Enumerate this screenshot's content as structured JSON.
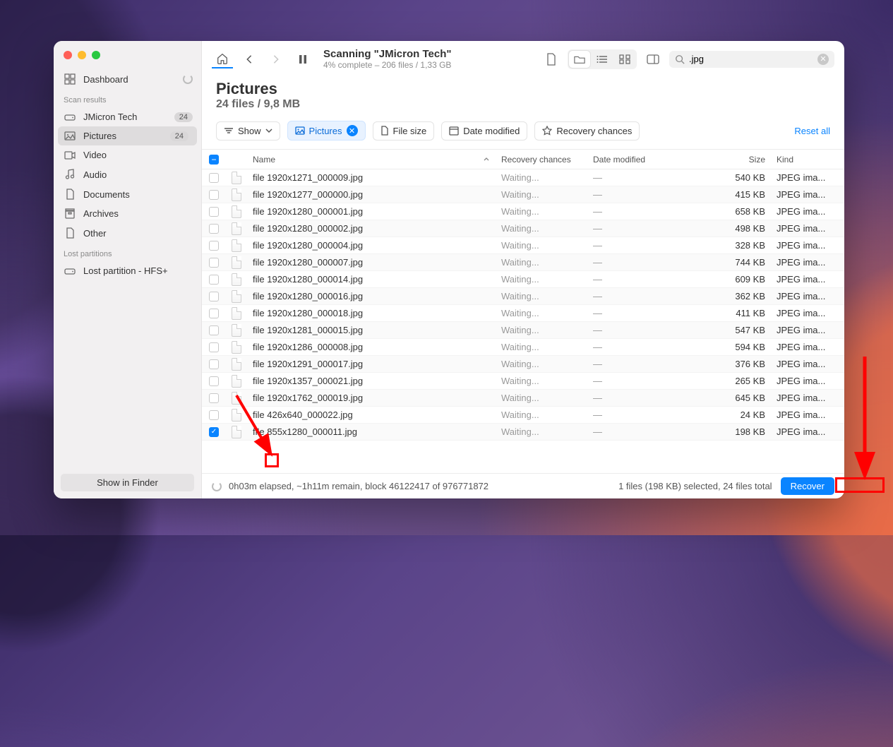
{
  "sidebar": {
    "dashboard": "Dashboard",
    "scan_results_header": "Scan results",
    "items": [
      {
        "id": "drive",
        "label": "JMicron Tech",
        "icon": "drive-icon",
        "badge": "24"
      },
      {
        "id": "pictures",
        "label": "Pictures",
        "icon": "picture-icon",
        "badge": "24",
        "selected": true
      },
      {
        "id": "video",
        "label": "Video",
        "icon": "video-icon"
      },
      {
        "id": "audio",
        "label": "Audio",
        "icon": "audio-icon"
      },
      {
        "id": "documents",
        "label": "Documents",
        "icon": "document-icon"
      },
      {
        "id": "archives",
        "label": "Archives",
        "icon": "archive-icon"
      },
      {
        "id": "other",
        "label": "Other",
        "icon": "other-icon"
      }
    ],
    "lost_header": "Lost partitions",
    "lost_items": [
      {
        "id": "hfs",
        "label": "Lost partition - HFS+",
        "icon": "drive-icon"
      }
    ],
    "show_in_finder": "Show in Finder"
  },
  "toolbar": {
    "scan_title": "Scanning \"JMicron Tech\"",
    "scan_sub": "4% complete – 206 files / 1,33 GB",
    "search_value": ".jpg"
  },
  "heading": {
    "title": "Pictures",
    "subtitle": "24 files / 9,8 MB"
  },
  "filters": {
    "show_label": "Show",
    "pictures_pill": "Pictures",
    "filesize_pill": "File size",
    "date_pill": "Date modified",
    "recovery_pill": "Recovery chances",
    "reset": "Reset all"
  },
  "columns": {
    "name": "Name",
    "recovery": "Recovery chances",
    "date": "Date modified",
    "size": "Size",
    "kind": "Kind"
  },
  "rows": [
    {
      "name": "file 1920x1271_000009.jpg",
      "rec": "Waiting...",
      "date": "—",
      "size": "540 KB",
      "kind": "JPEG ima...",
      "checked": false
    },
    {
      "name": "file 1920x1277_000000.jpg",
      "rec": "Waiting...",
      "date": "—",
      "size": "415 KB",
      "kind": "JPEG ima...",
      "checked": false
    },
    {
      "name": "file 1920x1280_000001.jpg",
      "rec": "Waiting...",
      "date": "—",
      "size": "658 KB",
      "kind": "JPEG ima...",
      "checked": false
    },
    {
      "name": "file 1920x1280_000002.jpg",
      "rec": "Waiting...",
      "date": "—",
      "size": "498 KB",
      "kind": "JPEG ima...",
      "checked": false
    },
    {
      "name": "file 1920x1280_000004.jpg",
      "rec": "Waiting...",
      "date": "—",
      "size": "328 KB",
      "kind": "JPEG ima...",
      "checked": false
    },
    {
      "name": "file 1920x1280_000007.jpg",
      "rec": "Waiting...",
      "date": "—",
      "size": "744 KB",
      "kind": "JPEG ima...",
      "checked": false
    },
    {
      "name": "file 1920x1280_000014.jpg",
      "rec": "Waiting...",
      "date": "—",
      "size": "609 KB",
      "kind": "JPEG ima...",
      "checked": false
    },
    {
      "name": "file 1920x1280_000016.jpg",
      "rec": "Waiting...",
      "date": "—",
      "size": "362 KB",
      "kind": "JPEG ima...",
      "checked": false
    },
    {
      "name": "file 1920x1280_000018.jpg",
      "rec": "Waiting...",
      "date": "—",
      "size": "411 KB",
      "kind": "JPEG ima...",
      "checked": false
    },
    {
      "name": "file 1920x1281_000015.jpg",
      "rec": "Waiting...",
      "date": "—",
      "size": "547 KB",
      "kind": "JPEG ima...",
      "checked": false
    },
    {
      "name": "file 1920x1286_000008.jpg",
      "rec": "Waiting...",
      "date": "—",
      "size": "594 KB",
      "kind": "JPEG ima...",
      "checked": false
    },
    {
      "name": "file 1920x1291_000017.jpg",
      "rec": "Waiting...",
      "date": "—",
      "size": "376 KB",
      "kind": "JPEG ima...",
      "checked": false
    },
    {
      "name": "file 1920x1357_000021.jpg",
      "rec": "Waiting...",
      "date": "—",
      "size": "265 KB",
      "kind": "JPEG ima...",
      "checked": false
    },
    {
      "name": "file 1920x1762_000019.jpg",
      "rec": "Waiting...",
      "date": "—",
      "size": "645 KB",
      "kind": "JPEG ima...",
      "checked": false
    },
    {
      "name": "file 426x640_000022.jpg",
      "rec": "Waiting...",
      "date": "—",
      "size": "24 KB",
      "kind": "JPEG ima...",
      "checked": false
    },
    {
      "name": "file 855x1280_000011.jpg",
      "rec": "Waiting...",
      "date": "—",
      "size": "198 KB",
      "kind": "JPEG ima...",
      "checked": true
    }
  ],
  "footer": {
    "elapsed": "0h03m elapsed, ~1h11m remain, block 46122417 of 976771872",
    "selection": "1 files (198 KB) selected, 24 files total",
    "recover": "Recover"
  }
}
